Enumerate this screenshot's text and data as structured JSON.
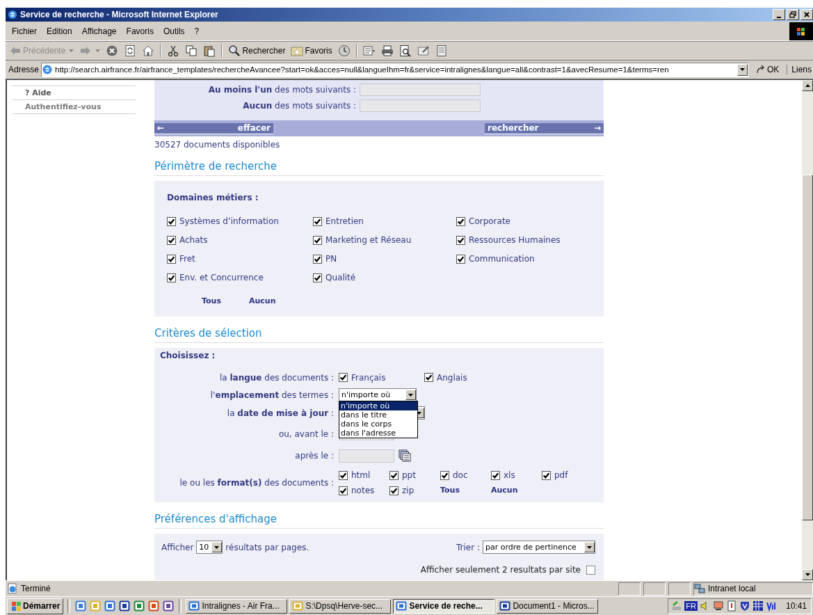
{
  "window": {
    "title": "Service de recherche - Microsoft Internet Explorer"
  },
  "menu": [
    "Fichier",
    "Edition",
    "Affichage",
    "Favoris",
    "Outils",
    "?"
  ],
  "toolbar": [
    {
      "kind": "back",
      "label": "Précédente",
      "disabled": true
    },
    {
      "kind": "forward",
      "disabled": true
    },
    {
      "kind": "stop"
    },
    {
      "kind": "refresh"
    },
    {
      "kind": "home"
    },
    {
      "kind": "sep"
    },
    {
      "kind": "cut"
    },
    {
      "kind": "copy"
    },
    {
      "kind": "paste"
    },
    {
      "kind": "sep"
    },
    {
      "kind": "search",
      "label": "Rechercher"
    },
    {
      "kind": "favorites",
      "label": "Favoris"
    },
    {
      "kind": "history"
    },
    {
      "kind": "sep"
    },
    {
      "kind": "mail"
    },
    {
      "kind": "print"
    },
    {
      "kind": "preview"
    },
    {
      "kind": "edit"
    },
    {
      "kind": "discuss"
    }
  ],
  "address": {
    "label": "Adresse",
    "value": "http://search.airfrance.fr/airfrance_templates/rechercheAvancee?start=ok&acces=null&langueIhm=fr&service=intralignes&langue=all&contrast=1&avecResume=1&terms=ren",
    "go": "OK",
    "links": "Liens"
  },
  "sidebar": {
    "items": [
      "? Aide",
      "Authentifiez-vous"
    ]
  },
  "search_form": {
    "fields": [
      {
        "label": "**Au moins l'un** des mots suivants :"
      },
      {
        "label": "**Aucun** des mots suivants :"
      }
    ],
    "clear_button": {
      "arrow": "←",
      "label": "effacer"
    },
    "search_button": {
      "label": "rechercher",
      "arrow": "→"
    },
    "count": "30527 documents disponibles"
  },
  "perimetre": {
    "heading": "Périmètre de recherche",
    "title": "Domaines métiers :",
    "domains": [
      {
        "label": "Systèmes d’information",
        "checked": true
      },
      {
        "label": "Entretien",
        "checked": true
      },
      {
        "label": "Corporate",
        "checked": true
      },
      {
        "label": "Achats",
        "checked": true
      },
      {
        "label": "Marketing et Réseau",
        "checked": true
      },
      {
        "label": "Ressources Humaines",
        "checked": true
      },
      {
        "label": "Fret",
        "checked": true
      },
      {
        "label": "PN",
        "checked": true
      },
      {
        "label": "Communication",
        "checked": true
      },
      {
        "label": "Env. et Concurrence",
        "checked": true
      },
      {
        "label": "Qualité",
        "checked": true
      }
    ],
    "links": [
      "Tous",
      "Aucun"
    ]
  },
  "criteres": {
    "heading": "Critères de sélection",
    "title": "Choisissez :",
    "rows": [
      {
        "kind": "checks",
        "label": "la **langue** des documents :",
        "options": [
          {
            "label": "Français",
            "checked": true
          },
          {
            "label": "Anglais",
            "checked": true
          }
        ]
      },
      {
        "kind": "select",
        "label": "l'**emplacement** des termes :",
        "value": "n'importe où",
        "options": [
          {
            "label": "n'importe où",
            "selected": true
          },
          {
            "label": "dans le titre",
            "selected": false
          },
          {
            "label": "dans le corps",
            "selected": false
          },
          {
            "label": "dans l'adresse",
            "selected": false
          }
        ]
      },
      {
        "kind": "select",
        "label": "la **date de mise à jour** :"
      },
      {
        "kind": "date",
        "label": "ou, avant le :"
      },
      {
        "kind": "date_calendar",
        "label": "après le :"
      },
      {
        "kind": "formats",
        "label": "le ou les **format(s)** des documents :",
        "options": [
          {
            "label": "html",
            "checked": true
          },
          {
            "label": "ppt",
            "checked": true
          },
          {
            "label": "doc",
            "checked": true
          },
          {
            "label": "xls",
            "checked": true
          },
          {
            "label": "pdf",
            "checked": true
          },
          {
            "label": "notes",
            "checked": true
          },
          {
            "label": "zip",
            "checked": true
          }
        ],
        "links": [
          "Tous",
          "Aucun"
        ]
      }
    ]
  },
  "preferences": {
    "heading": "Préférences d'affichage",
    "show_label": "Afficher",
    "show_value": "10",
    "show_suffix": "résultats par pages.",
    "sort_label": "Trier :",
    "sort_value": "par ordre de pertinence",
    "only_two": {
      "label": "Afficher seulement 2 resultats par site",
      "checked": false
    }
  },
  "status_bar": {
    "text": "Terminé",
    "zone": "Intranet local"
  },
  "taskbar": {
    "start": "Démarrer",
    "tasks": [
      {
        "label": "Intralignes - Air Fra...",
        "selected": false
      },
      {
        "label": "S:\\Dpsq\\Herve-sec...",
        "selected": false
      },
      {
        "label": "Service de reche...",
        "selected": true
      },
      {
        "label": "Document1 - Micros...",
        "selected": false
      }
    ],
    "language": "FR",
    "clock": "10:41"
  }
}
